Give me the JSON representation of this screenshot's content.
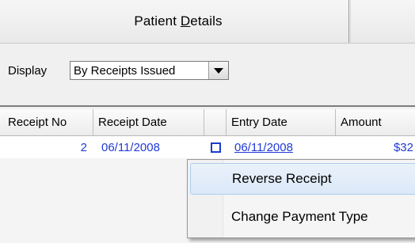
{
  "header": {
    "title_prefix": "Patient ",
    "title_mnemonic": "D",
    "title_suffix": "etails"
  },
  "display": {
    "label": "Display",
    "selected": "By Receipts Issued",
    "icon": "chevron-down-icon"
  },
  "grid": {
    "columns": [
      "Receipt No",
      "Receipt Date",
      "",
      "Entry Date",
      "Amount"
    ],
    "rows": [
      {
        "receipt_no": "2",
        "receipt_date": "06/11/2008",
        "checked": false,
        "entry_date": "06/11/2008",
        "amount": "$32"
      }
    ],
    "row_text_color": "#1f3ad8"
  },
  "context_menu": {
    "items": [
      "Reverse Receipt",
      "Change Payment Type"
    ],
    "highlighted_index": 0
  }
}
